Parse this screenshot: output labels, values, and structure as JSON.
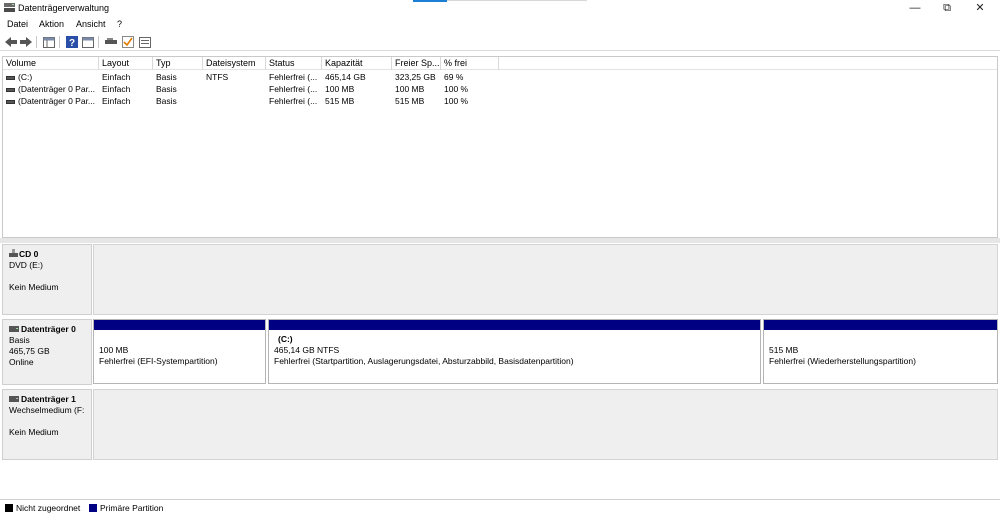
{
  "window": {
    "title": "Datenträgerverwaltung",
    "minimize": "—",
    "restore": "⧉",
    "close": "✕"
  },
  "menu": [
    "Datei",
    "Aktion",
    "Ansicht",
    "?"
  ],
  "columns": [
    "Volume",
    "Layout",
    "Typ",
    "Dateisystem",
    "Status",
    "Kapazität",
    "Freier Sp...",
    "% frei"
  ],
  "volumes": [
    [
      "(C:)",
      "Einfach",
      "Basis",
      "NTFS",
      "Fehlerfrei (...",
      "465,14 GB",
      "323,25 GB",
      "69 %"
    ],
    [
      "(Datenträger 0 Par...",
      "Einfach",
      "Basis",
      "",
      "Fehlerfrei (...",
      "100 MB",
      "100 MB",
      "100 %"
    ],
    [
      "(Datenträger 0 Par...",
      "Einfach",
      "Basis",
      "",
      "Fehlerfrei (...",
      "515 MB",
      "515 MB",
      "100 %"
    ]
  ],
  "disks": {
    "cd0": {
      "name": "CD 0",
      "line1": "DVD (E:)",
      "line2": "",
      "line3": "Kein Medium"
    },
    "disk0": {
      "name": "Datenträger 0",
      "line1": "Basis",
      "line2": "465,75 GB",
      "line3": "Online",
      "partitions": [
        {
          "title": "",
          "size": "100 MB",
          "status": "Fehlerfrei (EFI-Systempartition)"
        },
        {
          "title": "(C:)",
          "size": "465,14 GB NTFS",
          "status": "Fehlerfrei (Startpartition, Auslagerungsdatei, Absturzabbild, Basisdatenpartition)"
        },
        {
          "title": "",
          "size": "515 MB",
          "status": "Fehlerfrei (Wiederherstellungspartition)"
        }
      ]
    },
    "disk1": {
      "name": "Datenträger 1",
      "line1": "Wechselmedium (F:",
      "line2": "",
      "line3": "Kein Medium"
    }
  },
  "legend": [
    {
      "label": "Nicht zugeordnet",
      "color": "#000000"
    },
    {
      "label": "Primäre Partition",
      "color": "#000082"
    }
  ],
  "colors": {
    "partition_bar": "#000082",
    "accent": "#1b7fd6"
  }
}
